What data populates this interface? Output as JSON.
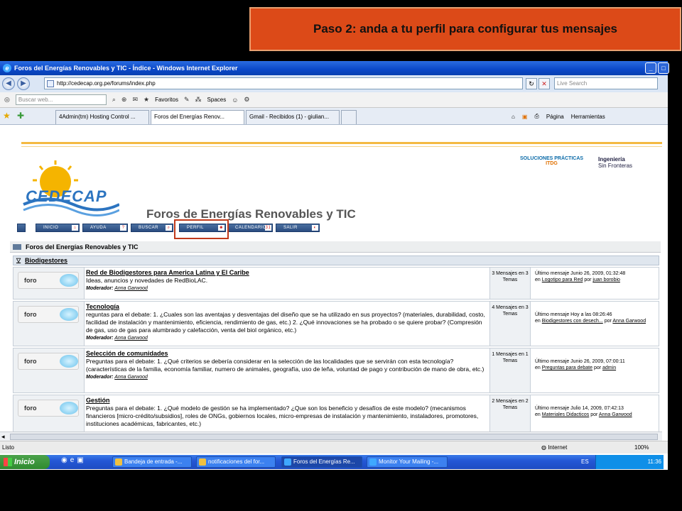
{
  "caption": "Paso 2: anda a tu perfil para configurar tus mensajes",
  "window": {
    "title": "Foros del Energías Renovables y TIC - Índice - Windows Internet Explorer",
    "url": "http://cedecap.org.pe/forums/index.php",
    "live_search_placeholder": "Live Search",
    "web_search_placeholder": "Buscar web...",
    "favoritos": "Favoritos",
    "spaces": "Spaces"
  },
  "tabs": [
    {
      "label": "4Admin(tm) Hosting Control ..."
    },
    {
      "label": "Foros del Energías Renov..."
    },
    {
      "label": "Gmail - Recibidos (1) - giulian..."
    }
  ],
  "tab_tools": {
    "pagina": "Página",
    "herramientas": "Herramientas"
  },
  "site": {
    "logo": "CEDECAP",
    "title": "Foros de Energías Renovables y TIC",
    "partner1": "SOLUCIONES PRÁCTICAS",
    "partner1_sub": "ITDG",
    "partner2": "Ingeniería",
    "partner2_sub": "Sin Fronteras"
  },
  "nav": [
    {
      "label": "INICIO"
    },
    {
      "label": "AYUDA"
    },
    {
      "label": "BUSCAR"
    },
    {
      "label": "PERFIL"
    },
    {
      "label": "CALENDARIO"
    },
    {
      "label": "SALIR"
    }
  ],
  "board": {
    "header": "Foros del Energías Renovables y TIC",
    "category": "Biodigestores"
  },
  "forums": [
    {
      "icon_label": "foro",
      "name": "Red de Biodigestores para America Latina y El Caribe",
      "desc": "Ideas, anuncios y novedades de RedBioLAC.",
      "moderator_label": "Moderador:",
      "moderator": "Anna Garwood",
      "stats": "3 Mensajes en 3 Temas",
      "last_line1": "Último mensaje Junio 26, 2009, 01:32:48",
      "last_prefix": "en",
      "last_topic": "Logotipo para Red",
      "last_by": "por",
      "last_user": "juan borobio"
    },
    {
      "icon_label": "foro",
      "name": "Tecnología",
      "desc": "reguntas para el debate: 1. ¿Cuales son las aventajas y desventajas del diseño que se ha utilizado en sus proyectos? (materiales, durabilidad, costo, facilidad de instalación y mantenimiento, eficiencia, rendimiento de gas, etc.) 2. ¿Qué innovaciones se ha probado o se quiere probar? (Compresión de gas, uso de gas para alumbrado y calefacción, venta del biol orgánico, etc.)",
      "moderator_label": "Moderador:",
      "moderator": "Anna Garwood",
      "stats": "4 Mensajes en 3 Temas",
      "last_line1": "Último mensaje Hoy a las 08:26:46",
      "last_prefix": "en",
      "last_topic": "Biodigestores con desech...",
      "last_by": "por",
      "last_user": "Anna Garwood"
    },
    {
      "icon_label": "foro",
      "name": "Selección de comunidades",
      "desc": "Preguntas para el debate: 1. ¿Qué criterios se debería considerar en la selección de las localidades que se servirán con esta tecnología? (características de la familia, economía familiar, numero de animales, geografía, uso de leña, voluntad de pago y contribución de mano de obra, etc.)",
      "moderator_label": "Moderador:",
      "moderator": "Anna Garwood",
      "stats": "1 Mensajes en 1 Temas",
      "last_line1": "Último mensaje Junio 26, 2009, 07:00:11",
      "last_prefix": "en",
      "last_topic": "Preguntas para debate",
      "last_by": "por",
      "last_user": "admin"
    },
    {
      "icon_label": "foro",
      "name": "Gestión",
      "desc": "Preguntas para el debate: 1. ¿Qué modelo de gestión se ha implementado? ¿Que son los beneficio y desafíos de este modelo? (mecanismos financieros [micro-crédito/subsidios], roles de ONGs, gobiernos locales, micro-empresas de instalación y mantenimiento, instaladores, promotores, instituciones académicas, fabricantes, etc.)",
      "moderator_label": "",
      "moderator": "",
      "stats": "2 Mensajes en 2 Temas",
      "last_line1": "Último mensaje Julio 14, 2009, 07:42:13",
      "last_prefix": "en",
      "last_topic": "Materiales Didacticos",
      "last_by": "por",
      "last_user": "Anna Garwood"
    }
  ],
  "status": {
    "left": "Listo",
    "zone": "Internet",
    "zoom": "100%"
  },
  "taskbar": {
    "start": "Inicio",
    "tasks": [
      {
        "label": "Bandeja de entrada -..."
      },
      {
        "label": "notificaciones del for..."
      },
      {
        "label": "Foros del Energías Re..."
      },
      {
        "label": "Monitor Your Mailing -..."
      }
    ],
    "lang": "ES",
    "time": "11:36"
  }
}
